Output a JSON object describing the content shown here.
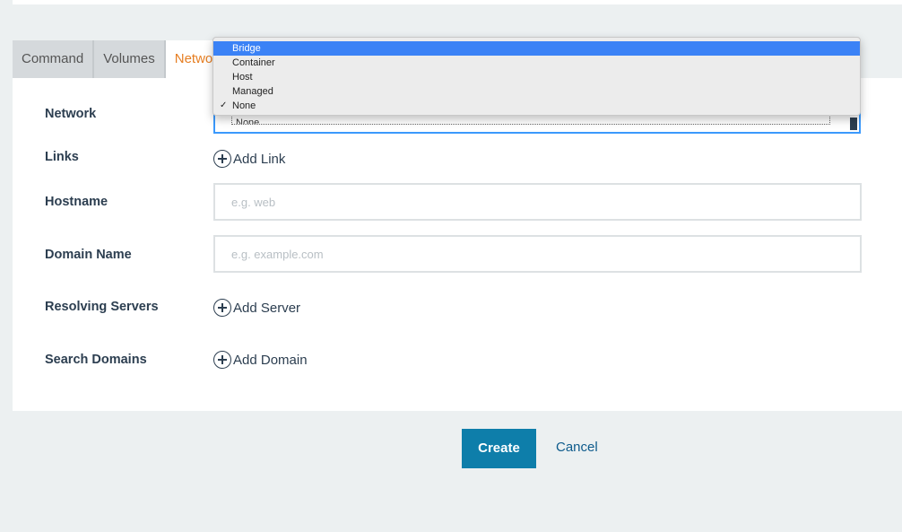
{
  "tabs": [
    {
      "label": "Command"
    },
    {
      "label": "Volumes"
    },
    {
      "label": "Network"
    }
  ],
  "form": {
    "network": {
      "label": "Network",
      "selected": "None"
    },
    "links": {
      "label": "Links",
      "action": "Add Link"
    },
    "hostname": {
      "label": "Hostname",
      "placeholder": "e.g. web",
      "value": ""
    },
    "domain_name": {
      "label": "Domain Name",
      "placeholder": "e.g. example.com",
      "value": ""
    },
    "resolving_servers": {
      "label": "Resolving Servers",
      "action": "Add Server"
    },
    "search_domains": {
      "label": "Search Domains",
      "action": "Add Domain"
    }
  },
  "dropdown": {
    "options": [
      "Bridge",
      "Container",
      "Host",
      "Managed",
      "None"
    ],
    "highlighted": "Bridge",
    "checked": "None",
    "check_glyph": "✓"
  },
  "buttons": {
    "create": "Create",
    "cancel": "Cancel"
  },
  "icons": {
    "add": "plus-circle-icon",
    "select_arrow": "chevron-down-icon"
  },
  "colors": {
    "accent": "#0e7eaa",
    "active_tab": "#e67e22",
    "focus": "#3b99fc",
    "highlight": "#3b82f6",
    "background": "#ecf0f1"
  }
}
